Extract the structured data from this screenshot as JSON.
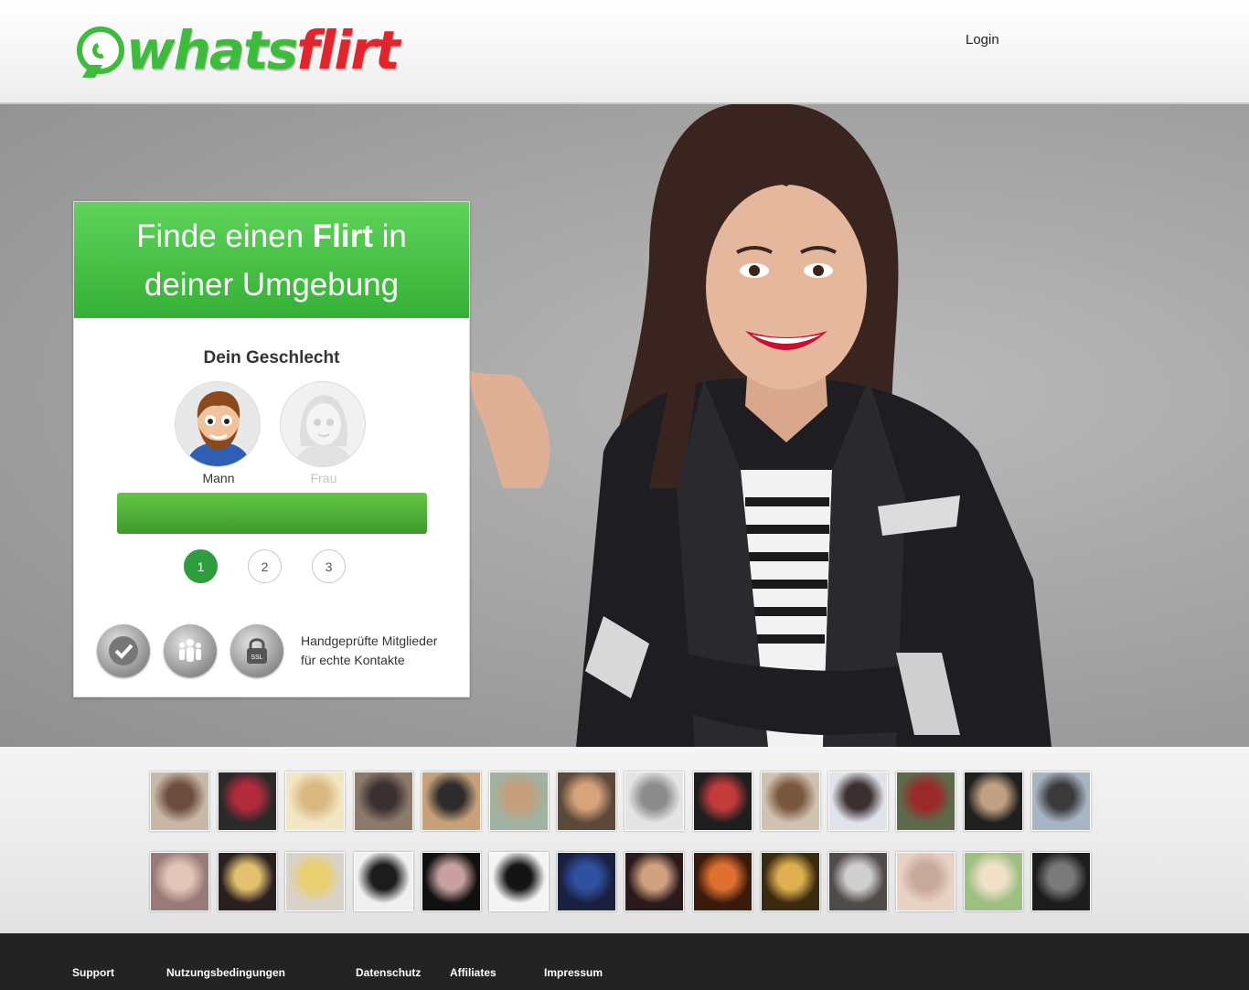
{
  "header": {
    "logo_part1": "whats",
    "logo_part2": "flirt",
    "login_label": "Login"
  },
  "signup": {
    "title_prefix": "Finde einen ",
    "title_bold": "Flirt",
    "title_suffix": " in",
    "title_line2": "deiner Umgebung",
    "gender_label": "Dein Geschlecht",
    "male_label": "Mann",
    "female_label": "Frau",
    "steps": [
      "1",
      "2",
      "3"
    ],
    "active_step": 1,
    "trust_line1": "Handgeprüfte Mitglieder",
    "trust_line2": "für echte Kontakte",
    "ssl_label": "SSL"
  },
  "photo_strip": {
    "rows": 2,
    "per_row": 14
  },
  "footer": {
    "links": [
      "Support",
      "Nutzungsbedingungen",
      "Datenschutz",
      "Affiliates",
      "Impressum"
    ]
  },
  "colors": {
    "brand_green": "#3dbb3b",
    "brand_red": "#e0262c",
    "button_green": "#4aae36",
    "step_active": "#2e9e3c",
    "footer_bg": "#232323"
  }
}
